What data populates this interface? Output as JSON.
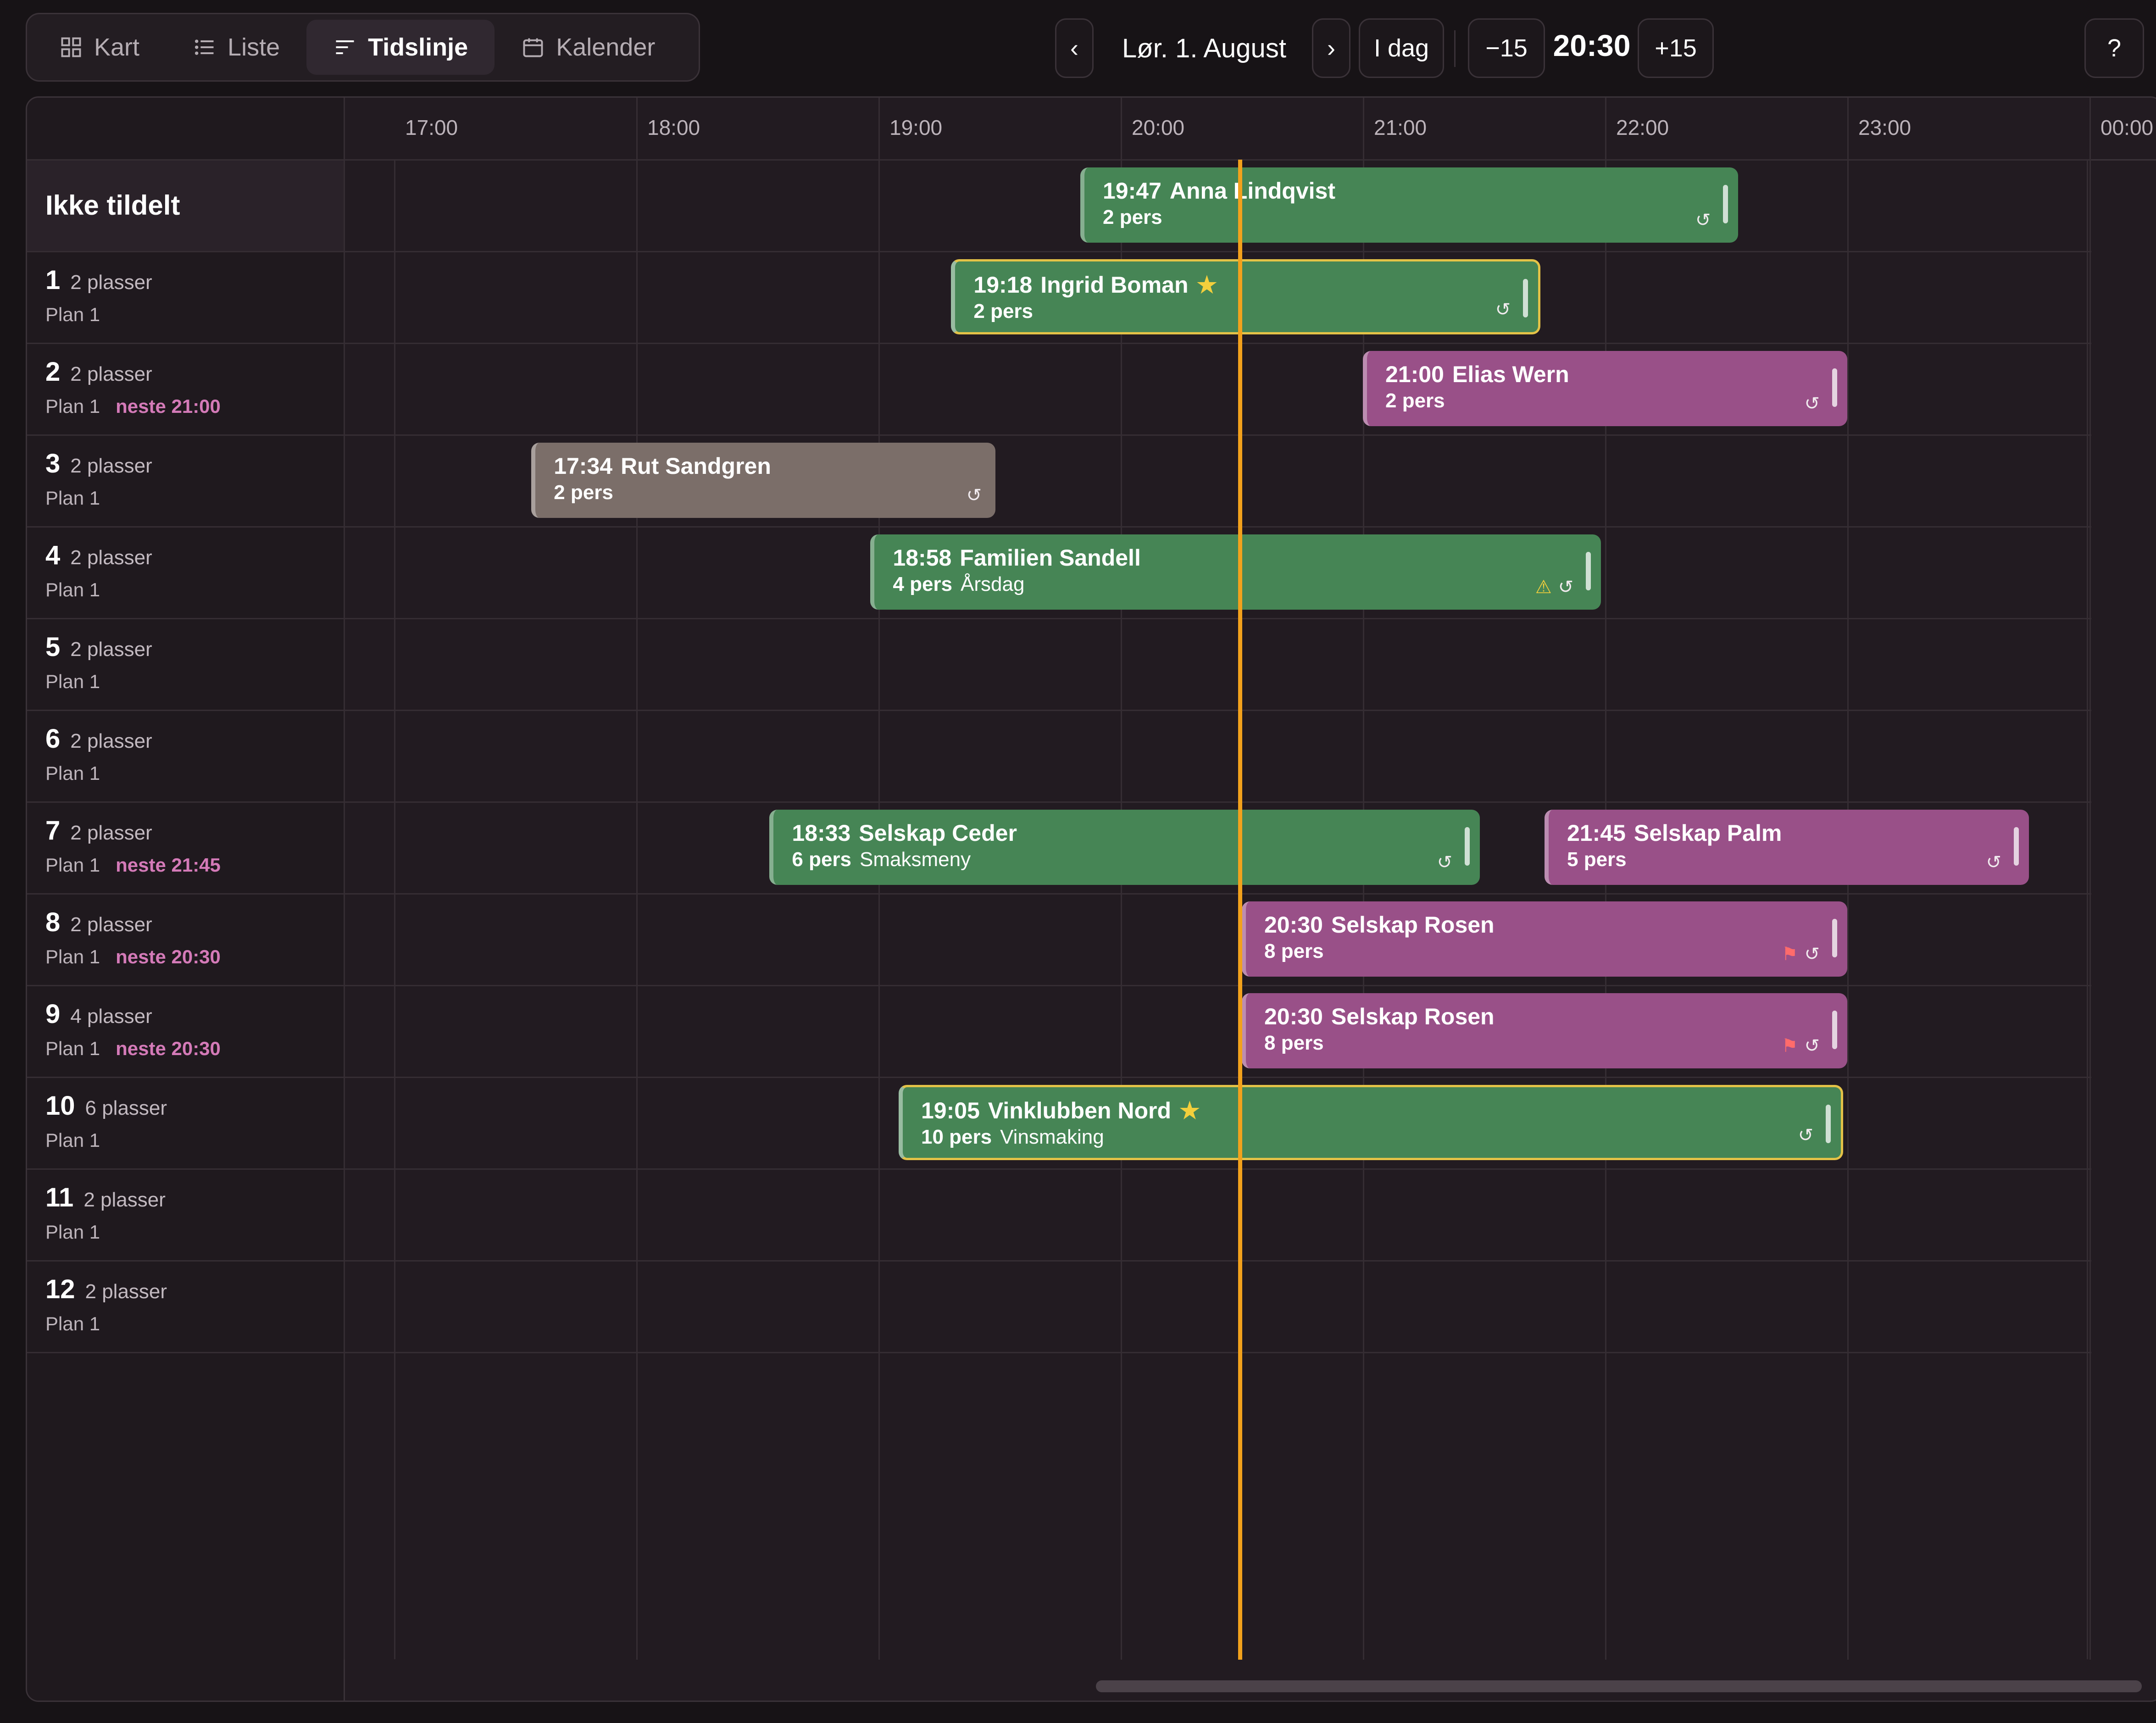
{
  "view_tabs": [
    {
      "label": "Kart",
      "icon": "grid-icon",
      "active": false
    },
    {
      "label": "Liste",
      "icon": "list-icon",
      "active": false
    },
    {
      "label": "Tidslinje",
      "icon": "timeline-icon",
      "active": true
    },
    {
      "label": "Kalender",
      "icon": "calendar-icon",
      "active": false
    }
  ],
  "nav": {
    "prev": "‹",
    "date": "Lør. 1. August",
    "next": "›",
    "today": "I dag",
    "minus": "−15",
    "time": "20:30",
    "plus": "+15",
    "help": "?"
  },
  "hours": [
    "17:00",
    "18:00",
    "19:00",
    "20:00",
    "21:00",
    "22:00",
    "23:00",
    "00:00"
  ],
  "unassigned_label": "Ikke tildelt",
  "tables": [
    {
      "num": "1",
      "seats": "2 plasser",
      "plan": "Plan 1",
      "next": ""
    },
    {
      "num": "2",
      "seats": "2 plasser",
      "plan": "Plan 1",
      "next": "neste 21:00"
    },
    {
      "num": "3",
      "seats": "2 plasser",
      "plan": "Plan 1",
      "next": ""
    },
    {
      "num": "4",
      "seats": "2 plasser",
      "plan": "Plan 1",
      "next": ""
    },
    {
      "num": "5",
      "seats": "2 plasser",
      "plan": "Plan 1",
      "next": ""
    },
    {
      "num": "6",
      "seats": "2 plasser",
      "plan": "Plan 1",
      "next": ""
    },
    {
      "num": "7",
      "seats": "2 plasser",
      "plan": "Plan 1",
      "next": "neste 21:45"
    },
    {
      "num": "8",
      "seats": "2 plasser",
      "plan": "Plan 1",
      "next": "neste 20:30"
    },
    {
      "num": "9",
      "seats": "4 plasser",
      "plan": "Plan 1",
      "next": "neste 20:30"
    },
    {
      "num": "10",
      "seats": "6 plasser",
      "plan": "Plan 1",
      "next": ""
    },
    {
      "num": "11",
      "seats": "2 plasser",
      "plan": "Plan 1",
      "next": ""
    },
    {
      "num": "12",
      "seats": "2 plasser",
      "plan": "Plan 1",
      "next": ""
    }
  ],
  "reservations": [
    {
      "time": "19:47",
      "name": "Anna Lindqvist",
      "guests": "2 pers",
      "note": "",
      "status": "green",
      "star": false,
      "flag": false,
      "warn": false
    },
    {
      "time": "19:18",
      "name": "Ingrid Boman",
      "guests": "2 pers",
      "note": "",
      "status": "green",
      "star": true,
      "flag": false,
      "warn": false
    },
    {
      "time": "21:00",
      "name": "Elias Wern",
      "guests": "2 pers",
      "note": "",
      "status": "purple",
      "star": false,
      "flag": false,
      "warn": false
    },
    {
      "time": "17:34",
      "name": "Rut Sandgren",
      "guests": "2 pers",
      "note": "",
      "status": "grey",
      "star": false,
      "flag": false,
      "warn": false
    },
    {
      "time": "18:58",
      "name": "Familien Sandell",
      "guests": "4 pers",
      "note": "Årsdag",
      "status": "green",
      "star": false,
      "flag": false,
      "warn": true
    },
    {
      "time": "18:33",
      "name": "Selskap Ceder",
      "guests": "6 pers",
      "note": "Smaksmeny",
      "status": "green",
      "star": false,
      "flag": false,
      "warn": false
    },
    {
      "time": "21:45",
      "name": "Selskap Palm",
      "guests": "5 pers",
      "note": "",
      "status": "purple",
      "star": false,
      "flag": false,
      "warn": false
    },
    {
      "time": "20:30",
      "name": "Selskap Rosen",
      "guests": "8 pers",
      "note": "",
      "status": "purple",
      "star": false,
      "flag": true,
      "warn": false
    },
    {
      "time": "20:30",
      "name": "Selskap Rosen",
      "guests": "8 pers",
      "note": "",
      "status": "purple",
      "star": false,
      "flag": true,
      "warn": false
    },
    {
      "time": "19:05",
      "name": "Vinklubben Nord",
      "guests": "10 pers",
      "note": "Vinsmaking",
      "status": "green",
      "star": true,
      "flag": false,
      "warn": false
    }
  ],
  "glyphs": {
    "star": "★",
    "flag": "⚑",
    "warn": "⚠",
    "repeat": "↺"
  },
  "colors": {
    "green": "#468555",
    "purple": "#995088",
    "grey": "#7b6e69",
    "now_line": "#f2a11c",
    "star": "#f3cf3c"
  }
}
